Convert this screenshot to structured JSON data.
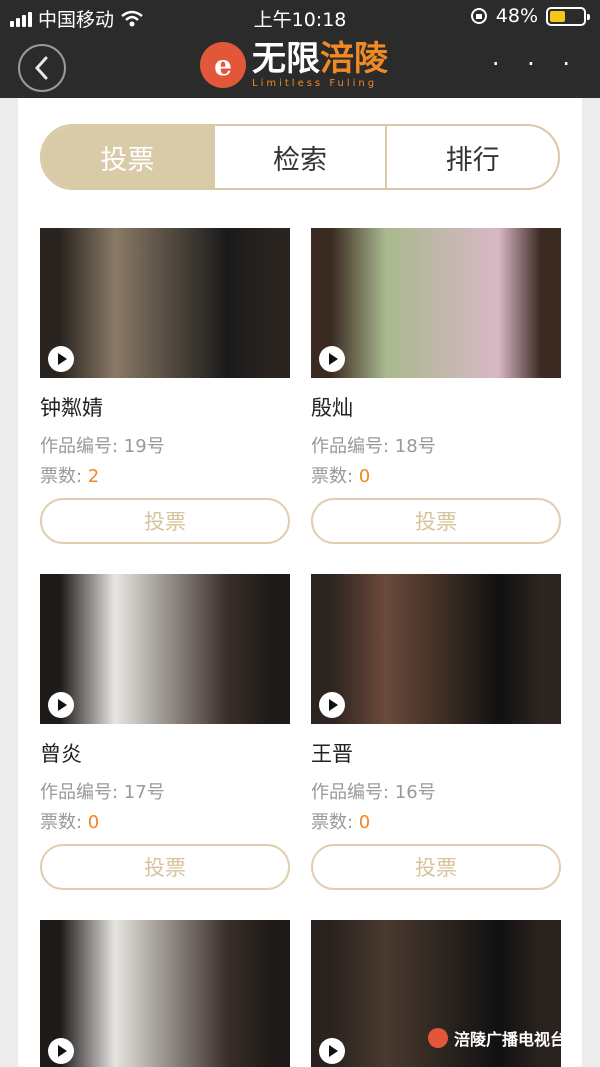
{
  "status_bar": {
    "carrier": "中国移动",
    "time": "上午10:18",
    "battery": "48%",
    "battery_level": 0.48
  },
  "header": {
    "logo_title_part1": "无限",
    "logo_title_part2": "涪陵",
    "logo_subtitle": "Limitless Fuling",
    "more_label": "· · ·"
  },
  "tabs": [
    {
      "label": "投票",
      "active": true
    },
    {
      "label": "检索",
      "active": false
    },
    {
      "label": "排行",
      "active": false
    }
  ],
  "entries": [
    {
      "name": "钟粼婧",
      "number": "作品编号: 19号",
      "votes_label": "票数: ",
      "votes": "2",
      "vote_button": "投票",
      "thumb_colors": [
        "#2a2420",
        "#8a7a66",
        "#1a1a1a"
      ]
    },
    {
      "name": "殷灿",
      "number": "作品编号: 18号",
      "votes_label": "票数: ",
      "votes": "0",
      "vote_button": "投票",
      "thumb_colors": [
        "#3a2a22",
        "#a9b98e",
        "#d9b7c6"
      ]
    },
    {
      "name": "曾炎",
      "number": "作品编号: 17号",
      "votes_label": "票数: ",
      "votes": "0",
      "vote_button": "投票",
      "thumb_colors": [
        "#1e1a18",
        "#e8e6e2",
        "#3a2e28"
      ]
    },
    {
      "name": "王晋",
      "number": "作品编号: 16号",
      "votes_label": "票数: ",
      "votes": "0",
      "vote_button": "投票",
      "thumb_colors": [
        "#2c2420",
        "#6b4a3a",
        "#111111"
      ]
    },
    {
      "name": "",
      "number": "",
      "votes_label": "",
      "votes": "",
      "vote_button": "",
      "thumb_colors": [
        "#1e1a18",
        "#e6e4e0",
        "#3a2e28"
      ]
    },
    {
      "name": "",
      "number": "",
      "votes_label": "",
      "votes": "",
      "vote_button": "",
      "thumb_colors": [
        "#2a221e",
        "#4a3a30",
        "#111111"
      ]
    }
  ],
  "watermark": "涪陵广播电视台",
  "colors": {
    "accent_gold": "#d9cba7",
    "vote_orange": "#f0881f",
    "header_bg": "#2b2b2b"
  }
}
